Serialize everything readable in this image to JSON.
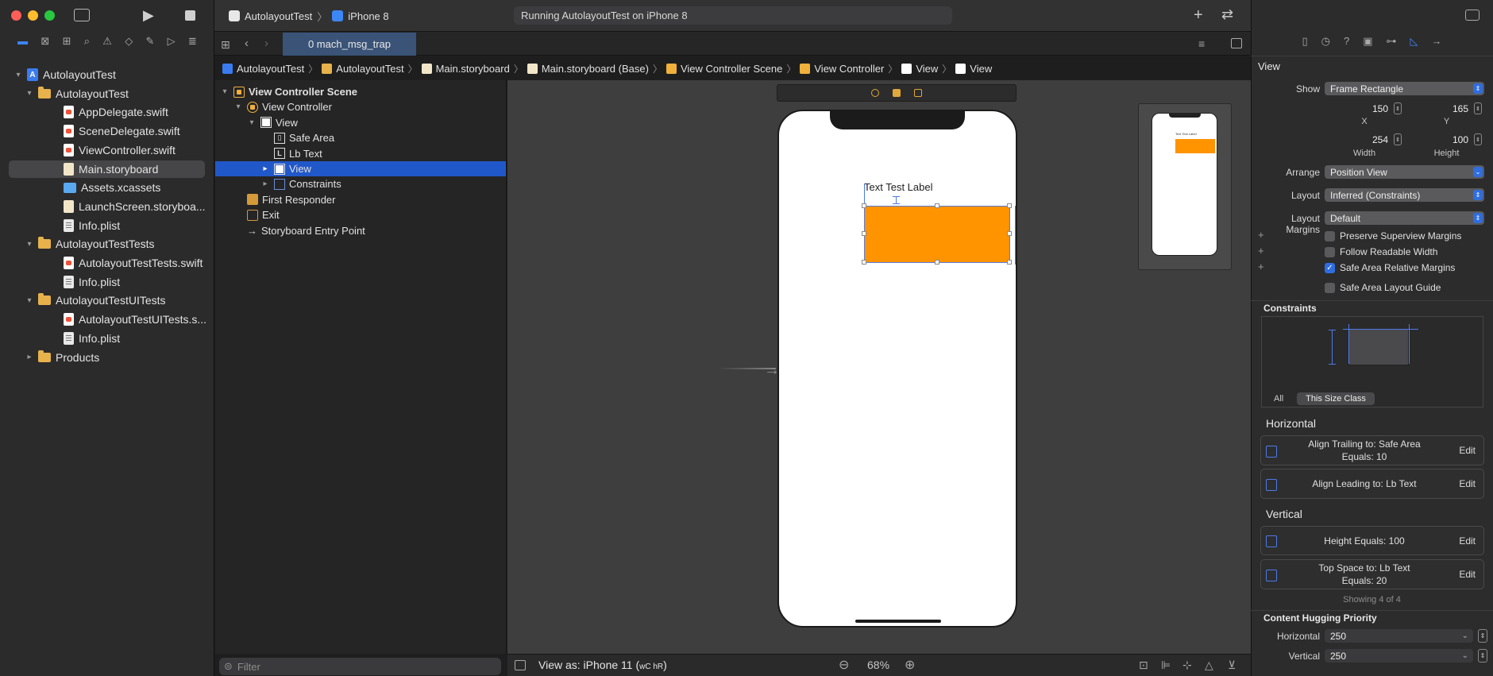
{
  "window": {
    "scheme": {
      "project": "AutolayoutTest",
      "device": "iPhone 8"
    },
    "status": "Running AutolayoutTest on iPhone 8"
  },
  "navigator": {
    "tree": [
      {
        "label": "AutolayoutTest",
        "type": "project",
        "depth": 0,
        "expanded": true
      },
      {
        "label": "AutolayoutTest",
        "type": "folder",
        "depth": 1,
        "expanded": true
      },
      {
        "label": "AppDelegate.swift",
        "type": "swift",
        "depth": 2
      },
      {
        "label": "SceneDelegate.swift",
        "type": "swift",
        "depth": 2
      },
      {
        "label": "ViewController.swift",
        "type": "swift",
        "depth": 2
      },
      {
        "label": "Main.storyboard",
        "type": "storyboard",
        "depth": 2,
        "selected": true
      },
      {
        "label": "Assets.xcassets",
        "type": "assets",
        "depth": 2
      },
      {
        "label": "LaunchScreen.storyboa...",
        "type": "storyboard",
        "depth": 2
      },
      {
        "label": "Info.plist",
        "type": "plist",
        "depth": 2
      },
      {
        "label": "AutolayoutTestTests",
        "type": "folder",
        "depth": 1,
        "expanded": true
      },
      {
        "label": "AutolayoutTestTests.swift",
        "type": "swift",
        "depth": 2
      },
      {
        "label": "Info.plist",
        "type": "plist",
        "depth": 2
      },
      {
        "label": "AutolayoutTestUITests",
        "type": "folder",
        "depth": 1,
        "expanded": true
      },
      {
        "label": "AutolayoutTestUITests.s...",
        "type": "swift",
        "depth": 2
      },
      {
        "label": "Info.plist",
        "type": "plist",
        "depth": 2
      },
      {
        "label": "Products",
        "type": "folder",
        "depth": 1,
        "expanded": false
      }
    ],
    "filter_placeholder": "Filter"
  },
  "editor": {
    "tab_label": "0 mach_msg_trap",
    "breadcrumbs": [
      "AutolayoutTest",
      "AutolayoutTest",
      "Main.storyboard",
      "Main.storyboard (Base)",
      "View Controller Scene",
      "View Controller",
      "View",
      "View"
    ]
  },
  "outline": {
    "rows": [
      {
        "label": "View Controller Scene",
        "icon": "scene-icon",
        "depth": 0,
        "disclosure": "open",
        "bold": true
      },
      {
        "label": "View Controller",
        "icon": "view-controller-icon",
        "depth": 1,
        "disclosure": "open"
      },
      {
        "label": "View",
        "icon": "view-icon",
        "depth": 2,
        "disclosure": "open"
      },
      {
        "label": "Safe Area",
        "icon": "safe-area-icon",
        "depth": 3,
        "disclosure": "none"
      },
      {
        "label": "Lb Text",
        "icon": "label-icon",
        "depth": 3,
        "disclosure": "none"
      },
      {
        "label": "View",
        "icon": "view-icon",
        "depth": 3,
        "disclosure": "closed",
        "selected": true
      },
      {
        "label": "Constraints",
        "icon": "constraints-icon",
        "depth": 3,
        "disclosure": "closed"
      },
      {
        "label": "First Responder",
        "icon": "first-responder-icon",
        "depth": 1,
        "disclosure": "none"
      },
      {
        "label": "Exit",
        "icon": "exit-icon",
        "depth": 1,
        "disclosure": "none"
      },
      {
        "label": "Storyboard Entry Point",
        "icon": "arrow-icon",
        "depth": 1,
        "disclosure": "none"
      }
    ]
  },
  "canvas": {
    "label_text": "Text Test Label",
    "orange_color": "#ff9300",
    "minimap_label": "Text Test Label",
    "view_as": "View as: iPhone 11 (",
    "view_as_size": "wC hR",
    "view_as_close": ")",
    "zoom": "68%"
  },
  "inspector": {
    "section_title": "View",
    "show_label": "Show",
    "show_value": "Frame Rectangle",
    "x": "150",
    "y": "165",
    "x_label": "X",
    "y_label": "Y",
    "width": "254",
    "height": "100",
    "width_label": "Width",
    "height_label": "Height",
    "arrange_label": "Arrange",
    "arrange_value": "Position View",
    "layout_label": "Layout",
    "layout_value": "Inferred (Constraints)",
    "margins_label": "Layout Margins",
    "margins_value": "Default",
    "checks": [
      {
        "label": "Preserve Superview Margins",
        "checked": false
      },
      {
        "label": "Follow Readable Width",
        "checked": false
      },
      {
        "label": "Safe Area Relative Margins",
        "checked": true
      },
      {
        "label": "Safe Area Layout Guide",
        "checked": false
      }
    ],
    "constraints_title": "Constraints",
    "cons_tab_all": "All",
    "cons_tab_size": "This Size Class",
    "horizontal_title": "Horizontal",
    "vertical_title": "Vertical",
    "horizontal": [
      {
        "line1": "Align Trailing to:  Safe Area",
        "line2": "Equals:  10",
        "edit": "Edit"
      },
      {
        "line1": "Align Leading to:  Lb Text",
        "line2": "",
        "edit": "Edit"
      }
    ],
    "vertical": [
      {
        "line1": "Height Equals:  100",
        "line2": "",
        "edit": "Edit"
      },
      {
        "line1": "Top Space to:  Lb Text",
        "line2": "Equals:  20",
        "edit": "Edit"
      }
    ],
    "showing": "Showing 4 of 4",
    "hugging_title": "Content Hugging Priority",
    "hug_h_label": "Horizontal",
    "hug_h_value": "250",
    "hug_v_label": "Vertical",
    "hug_v_value": "250"
  }
}
